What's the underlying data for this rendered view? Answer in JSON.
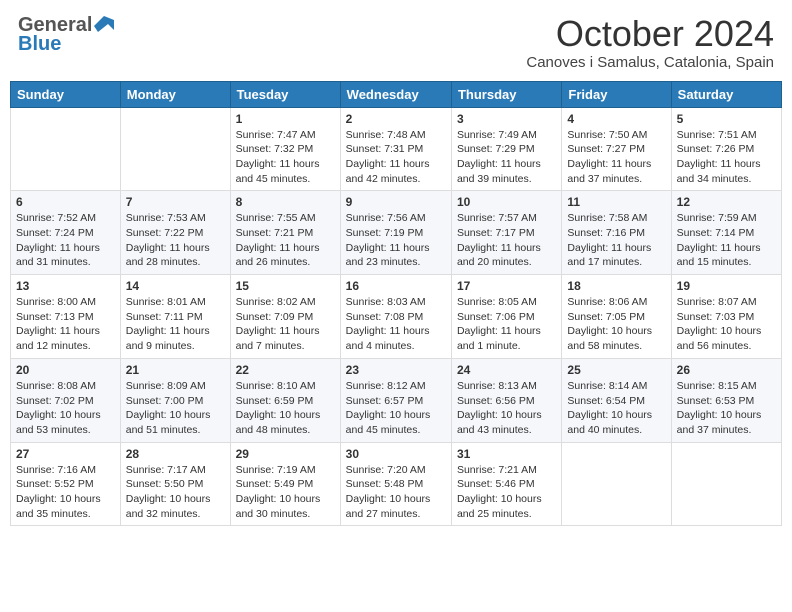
{
  "logo": {
    "line1": "General",
    "line2": "Blue"
  },
  "header": {
    "month": "October 2024",
    "location": "Canoves i Samalus, Catalonia, Spain"
  },
  "days_of_week": [
    "Sunday",
    "Monday",
    "Tuesday",
    "Wednesday",
    "Thursday",
    "Friday",
    "Saturday"
  ],
  "weeks": [
    [
      {
        "day": "",
        "content": ""
      },
      {
        "day": "",
        "content": ""
      },
      {
        "day": "1",
        "content": "Sunrise: 7:47 AM\nSunset: 7:32 PM\nDaylight: 11 hours and 45 minutes."
      },
      {
        "day": "2",
        "content": "Sunrise: 7:48 AM\nSunset: 7:31 PM\nDaylight: 11 hours and 42 minutes."
      },
      {
        "day": "3",
        "content": "Sunrise: 7:49 AM\nSunset: 7:29 PM\nDaylight: 11 hours and 39 minutes."
      },
      {
        "day": "4",
        "content": "Sunrise: 7:50 AM\nSunset: 7:27 PM\nDaylight: 11 hours and 37 minutes."
      },
      {
        "day": "5",
        "content": "Sunrise: 7:51 AM\nSunset: 7:26 PM\nDaylight: 11 hours and 34 minutes."
      }
    ],
    [
      {
        "day": "6",
        "content": "Sunrise: 7:52 AM\nSunset: 7:24 PM\nDaylight: 11 hours and 31 minutes."
      },
      {
        "day": "7",
        "content": "Sunrise: 7:53 AM\nSunset: 7:22 PM\nDaylight: 11 hours and 28 minutes."
      },
      {
        "day": "8",
        "content": "Sunrise: 7:55 AM\nSunset: 7:21 PM\nDaylight: 11 hours and 26 minutes."
      },
      {
        "day": "9",
        "content": "Sunrise: 7:56 AM\nSunset: 7:19 PM\nDaylight: 11 hours and 23 minutes."
      },
      {
        "day": "10",
        "content": "Sunrise: 7:57 AM\nSunset: 7:17 PM\nDaylight: 11 hours and 20 minutes."
      },
      {
        "day": "11",
        "content": "Sunrise: 7:58 AM\nSunset: 7:16 PM\nDaylight: 11 hours and 17 minutes."
      },
      {
        "day": "12",
        "content": "Sunrise: 7:59 AM\nSunset: 7:14 PM\nDaylight: 11 hours and 15 minutes."
      }
    ],
    [
      {
        "day": "13",
        "content": "Sunrise: 8:00 AM\nSunset: 7:13 PM\nDaylight: 11 hours and 12 minutes."
      },
      {
        "day": "14",
        "content": "Sunrise: 8:01 AM\nSunset: 7:11 PM\nDaylight: 11 hours and 9 minutes."
      },
      {
        "day": "15",
        "content": "Sunrise: 8:02 AM\nSunset: 7:09 PM\nDaylight: 11 hours and 7 minutes."
      },
      {
        "day": "16",
        "content": "Sunrise: 8:03 AM\nSunset: 7:08 PM\nDaylight: 11 hours and 4 minutes."
      },
      {
        "day": "17",
        "content": "Sunrise: 8:05 AM\nSunset: 7:06 PM\nDaylight: 11 hours and 1 minute."
      },
      {
        "day": "18",
        "content": "Sunrise: 8:06 AM\nSunset: 7:05 PM\nDaylight: 10 hours and 58 minutes."
      },
      {
        "day": "19",
        "content": "Sunrise: 8:07 AM\nSunset: 7:03 PM\nDaylight: 10 hours and 56 minutes."
      }
    ],
    [
      {
        "day": "20",
        "content": "Sunrise: 8:08 AM\nSunset: 7:02 PM\nDaylight: 10 hours and 53 minutes."
      },
      {
        "day": "21",
        "content": "Sunrise: 8:09 AM\nSunset: 7:00 PM\nDaylight: 10 hours and 51 minutes."
      },
      {
        "day": "22",
        "content": "Sunrise: 8:10 AM\nSunset: 6:59 PM\nDaylight: 10 hours and 48 minutes."
      },
      {
        "day": "23",
        "content": "Sunrise: 8:12 AM\nSunset: 6:57 PM\nDaylight: 10 hours and 45 minutes."
      },
      {
        "day": "24",
        "content": "Sunrise: 8:13 AM\nSunset: 6:56 PM\nDaylight: 10 hours and 43 minutes."
      },
      {
        "day": "25",
        "content": "Sunrise: 8:14 AM\nSunset: 6:54 PM\nDaylight: 10 hours and 40 minutes."
      },
      {
        "day": "26",
        "content": "Sunrise: 8:15 AM\nSunset: 6:53 PM\nDaylight: 10 hours and 37 minutes."
      }
    ],
    [
      {
        "day": "27",
        "content": "Sunrise: 7:16 AM\nSunset: 5:52 PM\nDaylight: 10 hours and 35 minutes."
      },
      {
        "day": "28",
        "content": "Sunrise: 7:17 AM\nSunset: 5:50 PM\nDaylight: 10 hours and 32 minutes."
      },
      {
        "day": "29",
        "content": "Sunrise: 7:19 AM\nSunset: 5:49 PM\nDaylight: 10 hours and 30 minutes."
      },
      {
        "day": "30",
        "content": "Sunrise: 7:20 AM\nSunset: 5:48 PM\nDaylight: 10 hours and 27 minutes."
      },
      {
        "day": "31",
        "content": "Sunrise: 7:21 AM\nSunset: 5:46 PM\nDaylight: 10 hours and 25 minutes."
      },
      {
        "day": "",
        "content": ""
      },
      {
        "day": "",
        "content": ""
      }
    ]
  ]
}
